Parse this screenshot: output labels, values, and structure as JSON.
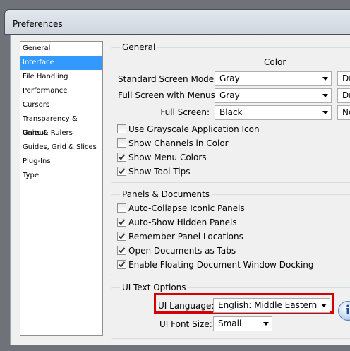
{
  "window": {
    "title": "Preferences"
  },
  "sidebar": {
    "items": [
      {
        "label": "General",
        "selected": false
      },
      {
        "label": "Interface",
        "selected": true
      },
      {
        "label": "File Handling",
        "selected": false
      },
      {
        "label": "Performance",
        "selected": false
      },
      {
        "label": "Cursors",
        "selected": false
      },
      {
        "label": "Transparency & Gamut",
        "selected": false
      },
      {
        "label": "Units & Rulers",
        "selected": false
      },
      {
        "label": "Guides, Grid & Slices",
        "selected": false
      },
      {
        "label": "Plug-Ins",
        "selected": false
      },
      {
        "label": "Type",
        "selected": false
      }
    ]
  },
  "general": {
    "legend": "General",
    "column_header": "Color",
    "standard_screen_mode": {
      "label": "Standard Screen Mode:",
      "color": "Gray",
      "next": "Dr"
    },
    "full_screen_menus": {
      "label": "Full Screen with Menus:",
      "color": "Gray",
      "next": "Dr"
    },
    "full_screen": {
      "label": "Full Screen:",
      "color": "Black",
      "next": "No"
    },
    "checkboxes": [
      {
        "label": "Use Grayscale Application Icon",
        "checked": false
      },
      {
        "label": "Show Channels in Color",
        "checked": false
      },
      {
        "label": "Show Menu Colors",
        "checked": true
      },
      {
        "label": "Show Tool Tips",
        "checked": true
      }
    ]
  },
  "panels": {
    "legend": "Panels & Documents",
    "checkboxes": [
      {
        "label": "Auto-Collapse Iconic Panels",
        "checked": false
      },
      {
        "label": "Auto-Show Hidden Panels",
        "checked": true
      },
      {
        "label": "Remember Panel Locations",
        "checked": true
      },
      {
        "label": "Open Documents as Tabs",
        "checked": true
      },
      {
        "label": "Enable Floating Document Window Docking",
        "checked": true
      }
    ]
  },
  "ui_text": {
    "legend": "UI Text Options",
    "language": {
      "label": "UI Language:",
      "value": "English: Middle Eastern"
    },
    "font_size": {
      "label": "UI Font Size:",
      "value": "Small"
    },
    "highlight_color": "#d40000",
    "info_glyph": "i"
  }
}
